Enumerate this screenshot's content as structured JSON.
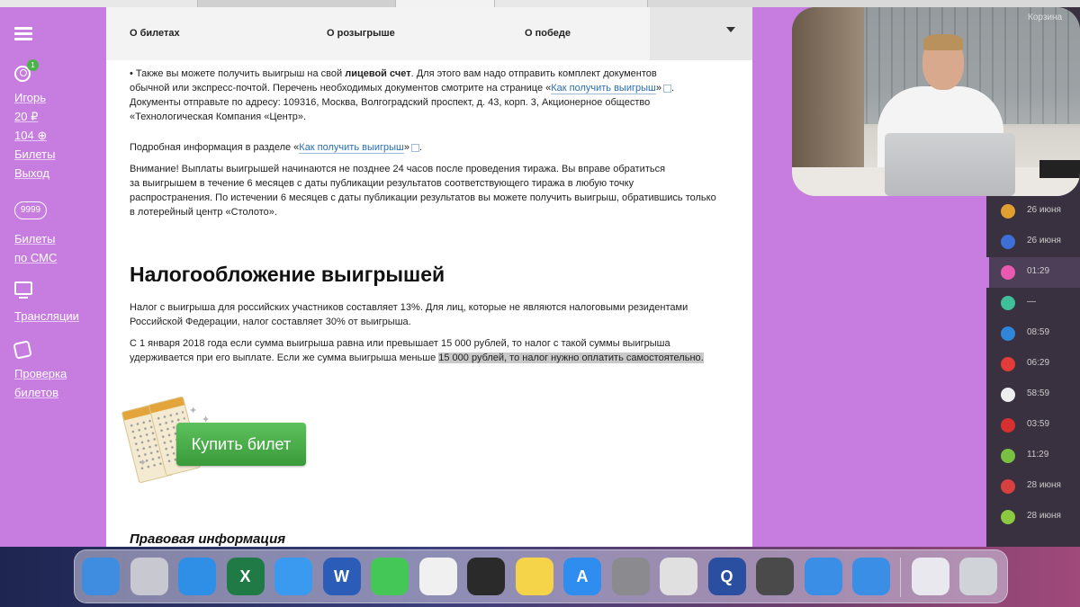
{
  "topnav": {
    "items": [
      "О билетах",
      "О розыгрыше",
      "О победе"
    ]
  },
  "sidebar": {
    "user_badge": "1",
    "user_name": "Игорь",
    "balance_rub": "20 ₽",
    "bonus": "104",
    "tickets": "Билеты",
    "logout": "Выход",
    "sms_icon_text": "9999",
    "sms_line1": "Билеты",
    "sms_line2": "по СМС",
    "broadcasts": "Трансляции",
    "check_line1": "Проверка",
    "check_line2": "билетов"
  },
  "content": {
    "p1": {
      "bullet": "• Также вы можете получить выигрыш на свой ",
      "bold": "лицевой счет",
      "rest1": ". Для этого вам надо отправить комплект документов",
      "line2": "обычной или экспресс-почтой. Перечень необходимых документов смотрите на странице «",
      "link": "Как получить выигрыш",
      "close": "»",
      "line3": "Документы отправьте по адресу: 109316, Москва, Волгоградский проспект, д. 43, корп. 3, Акционерное общество",
      "line4": "«Технологическая Компания «Центр»."
    },
    "p2": {
      "pre": "Подробная информация в разделе «",
      "link": "Как получить выигрыш",
      "post": "»"
    },
    "p3": [
      "Внимание! Выплаты выигрышей начинаются не позднее 24 часов после проведения тиража. Вы вправе обратиться",
      "за выигрышем в течение 6 месяцев с даты публикации результатов соответствующего тиража в любую точку",
      "распространения. По истечении 6 месяцев с даты публикации результатов вы можете получить выигрыш, обратившись только",
      "в лотерейный центр «Столото»."
    ],
    "tax_heading": "Налогообложение выигрышей",
    "tax_p1": [
      "Налог с выигрыша для российских участников составляет 13%. Для лиц, которые не являются налоговыми резидентами",
      "Российской Федерации, налог составляет 30% от выигрыша."
    ],
    "tax_p2_line1": "С 1 января 2018 года если сумма выигрыша равна или превышает 15 000 рублей, то налог с такой суммы выигрыша",
    "tax_p2_line2a": "удерживается при его выплате. Если же сумма выигрыша меньше ",
    "tax_p2_line2b": "15 000 рублей, то налог нужно оплатить самостоятельно.",
    "buy_button": "Купить билет",
    "legal_heading": "Правовая информация"
  },
  "rightpanel": {
    "cart": "Корзина",
    "draws": [
      {
        "time": "26 июня",
        "color": "#e0a030",
        "icon": "lottery-6-45-icon"
      },
      {
        "time": "26 июня",
        "color": "#3d6fd6",
        "icon": "lottery-gosloto-icon"
      },
      {
        "time": "01:29",
        "color": "#e85ab0",
        "icon": "lottery-4-20-icon",
        "active": true
      },
      {
        "time": "—",
        "color": "#3fbf9a",
        "icon": "lottery-zodiac-icon"
      },
      {
        "time": "08:59",
        "color": "#2f86d8",
        "icon": "lottery-12-24-icon"
      },
      {
        "time": "06:29",
        "color": "#e33a3a",
        "icon": "lottery-rapido-icon"
      },
      {
        "time": "58:59",
        "color": "#eeeeee",
        "icon": "lottery-top3-icon"
      },
      {
        "time": "03:59",
        "color": "#d83030",
        "icon": "lottery-5-36-icon"
      },
      {
        "time": "11:29",
        "color": "#7ac043",
        "icon": "lottery-keno-icon"
      },
      {
        "time": "28 июня",
        "color": "#d84040",
        "icon": "lottery-housing-icon"
      },
      {
        "time": "28 июня",
        "color": "#8cc840",
        "icon": "lottery-bingo-icon"
      }
    ]
  },
  "dock": {
    "apps": [
      {
        "name": "finder-icon",
        "label": "",
        "color": "#3f8de0"
      },
      {
        "name": "launchpad-icon",
        "label": "",
        "color": "#c8c8d0"
      },
      {
        "name": "safari-icon",
        "label": "",
        "color": "#2f8fe6"
      },
      {
        "name": "excel-icon",
        "label": "X",
        "color": "#1f7a45"
      },
      {
        "name": "mail-icon",
        "label": "",
        "color": "#3a9af0"
      },
      {
        "name": "word-icon",
        "label": "W",
        "color": "#2b5cb8"
      },
      {
        "name": "messages-icon",
        "label": "",
        "color": "#45c758"
      },
      {
        "name": "photos-icon",
        "label": "",
        "color": "#f0f0f0"
      },
      {
        "name": "final-cut-icon",
        "label": "",
        "color": "#2a2a2a"
      },
      {
        "name": "notes-icon",
        "label": "",
        "color": "#f5d44a"
      },
      {
        "name": "app-store-icon",
        "label": "A",
        "color": "#2f8df0"
      },
      {
        "name": "system-preferences-icon",
        "label": "",
        "color": "#8a8a8f"
      },
      {
        "name": "chrome-icon",
        "label": "",
        "color": "#e0e0e0"
      },
      {
        "name": "quicktime-icon",
        "label": "Q",
        "color": "#2a4fa0"
      },
      {
        "name": "calculator-icon",
        "label": "",
        "color": "#4a4a4a"
      },
      {
        "name": "xcode-icon",
        "label": "",
        "color": "#3a8ee6"
      },
      {
        "name": "xcode-2-icon",
        "label": "",
        "color": "#3a8ee6"
      },
      {
        "name": "document-preview-icon",
        "label": "",
        "color": "#e8e8ee"
      },
      {
        "name": "trash-icon",
        "label": "",
        "color": "#d0d4d8"
      }
    ]
  }
}
